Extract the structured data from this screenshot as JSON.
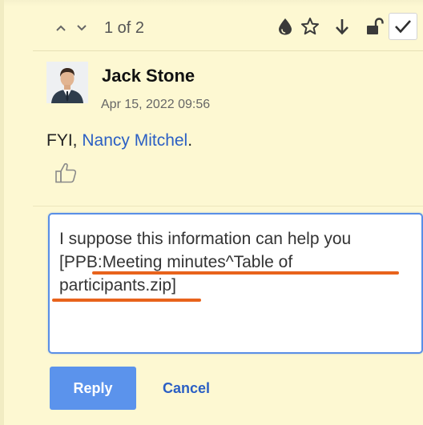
{
  "header": {
    "counter": "1 of 2"
  },
  "comment": {
    "author": "Jack Stone",
    "timestamp": "Apr 15, 2022 09:56",
    "body_prefix": "FYI, ",
    "mention": "Nancy Mitchel",
    "body_suffix": "."
  },
  "reply": {
    "text_before_ref": "I suppose this information can help you ",
    "reference": "[PPB:Meeting minutes^Table of participants.zip]",
    "reply_label": "Reply",
    "cancel_label": "Cancel"
  },
  "colors": {
    "panel_background": "#fdf8d2",
    "link": "#2b5fc4",
    "reply_button": "#5b93ec",
    "focus_border": "#5a8fe6",
    "annotation_underline": "#e8631c"
  },
  "icons": {
    "prev": "chevron-up-icon",
    "next": "chevron-down-icon",
    "drop": "drop-icon",
    "star": "star-icon",
    "arrow_down": "arrow-down-icon",
    "lock": "unlock-icon",
    "resolve": "checkmark-icon",
    "like": "thumbs-up-icon"
  }
}
